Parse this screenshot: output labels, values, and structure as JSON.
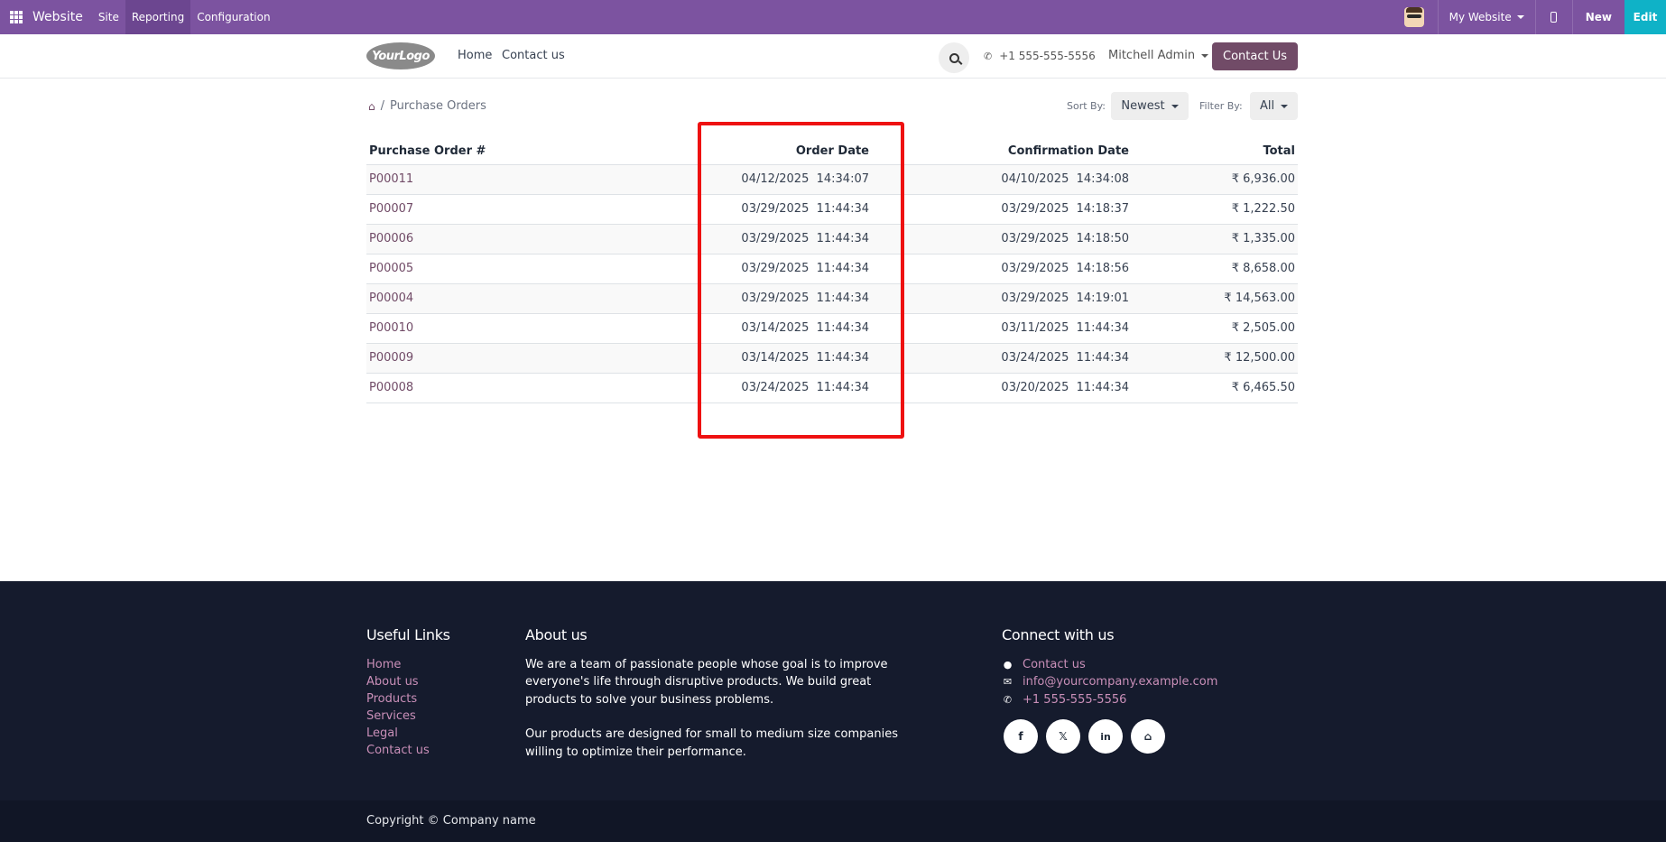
{
  "adminbar": {
    "app_name": "Website",
    "menu": [
      "Site",
      "Reporting",
      "Configuration"
    ],
    "website_selector": "My Website",
    "new_label": "New",
    "edit_label": "Edit",
    "color": "#7c53a0",
    "edit_color": "#0fb2c7"
  },
  "header": {
    "logo_text": "YourLogo",
    "nav": [
      "Home",
      "Contact us"
    ],
    "phone": "+1 555-555-5556",
    "user": "Mitchell Admin",
    "contact_button": "Contact Us",
    "brand_color": "#714b67"
  },
  "main": {
    "breadcrumb": "Purchase Orders",
    "sort_label": "Sort By:",
    "sort_value": "Newest",
    "filter_label": "Filter By:",
    "filter_value": "All",
    "table": {
      "headers": [
        "Purchase Order #",
        "Order Date",
        "Confirmation Date",
        "Total"
      ],
      "rows": [
        [
          "P00011",
          "04/12/2025  14:34:07",
          "04/10/2025  14:34:08",
          "₹ 6,936.00"
        ],
        [
          "P00007",
          "03/29/2025  11:44:34",
          "03/29/2025  14:18:37",
          "₹ 1,222.50"
        ],
        [
          "P00006",
          "03/29/2025  11:44:34",
          "03/29/2025  14:18:50",
          "₹ 1,335.00"
        ],
        [
          "P00005",
          "03/29/2025  11:44:34",
          "03/29/2025  14:18:56",
          "₹ 8,658.00"
        ],
        [
          "P00004",
          "03/29/2025  11:44:34",
          "03/29/2025  14:19:01",
          "₹ 14,563.00"
        ],
        [
          "P00010",
          "03/14/2025  11:44:34",
          "03/11/2025  11:44:34",
          "₹ 2,505.00"
        ],
        [
          "P00009",
          "03/14/2025  11:44:34",
          "03/24/2025  11:44:34",
          "₹ 12,500.00"
        ],
        [
          "P00008",
          "03/24/2025  11:44:34",
          "03/20/2025  11:44:34",
          "₹ 6,465.50"
        ]
      ]
    },
    "highlight_color": "#ee1111"
  },
  "footer": {
    "useful_links_title": "Useful Links",
    "useful_links": [
      "Home",
      "About us",
      "Products",
      "Services",
      "Legal",
      "Contact us"
    ],
    "about_title": "About us",
    "about_p1": "We are a team of passionate people whose goal is to improve everyone's life through disruptive products. We build great products to solve your business problems.",
    "about_p2": "Our products are designed for small to medium size companies willing to optimize their performance.",
    "connect_title": "Connect with us",
    "connect_contact": "Contact us",
    "connect_email": "info@yourcompany.example.com",
    "connect_phone": "+1 555-555-5556",
    "social_icons": [
      "facebook-icon",
      "x-icon",
      "linkedin-icon",
      "home-icon"
    ],
    "copyright": "Copyright © Company name",
    "background": "#151b2d"
  }
}
